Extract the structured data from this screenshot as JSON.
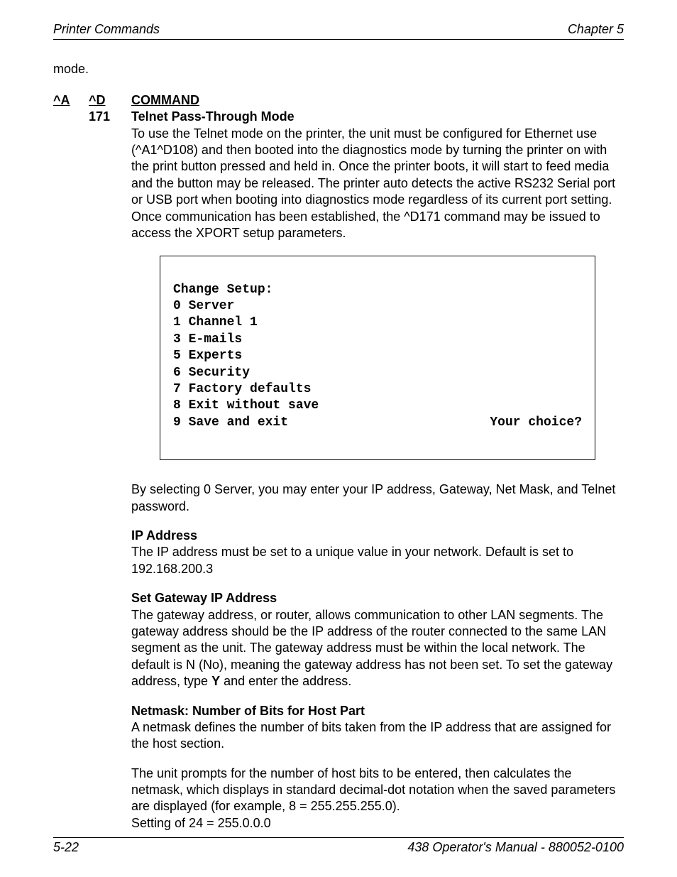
{
  "header": {
    "left": "Printer Commands",
    "right": "Chapter 5"
  },
  "top_text": "mode.",
  "cmd": {
    "colA": "^A",
    "colD": "^D",
    "colCmd": "COMMAND",
    "num": "171",
    "title": "Telnet Pass-Through Mode",
    "intro": "To use the Telnet mode on the printer, the unit must be configured for Ethernet use (^A1^D108) and then booted into the diagnostics mode by turning the printer on with the print button pressed and held in.  Once the printer boots, it will start to feed media and the button may be released.  The printer auto detects the active RS232 Serial port or USB port when booting into diagnostics mode regardless of its current port setting. Once communication has been established, the ^D171 command may be issued to access the XPORT setup parameters."
  },
  "codebox": {
    "line0": "Change Setup:",
    "line1": "0 Server",
    "line2": "1 Channel 1",
    "line3": "3 E-mails",
    "line4": "5 Experts",
    "line5": "6 Security",
    "line6": "7 Factory defaults",
    "line7": "8 Exit without save",
    "line8_left": "9 Save and exit",
    "line8_right": "Your choice?"
  },
  "sections": {
    "server_note": "By selecting 0 Server, you may enter your IP address, Gateway, Net Mask, and Telnet password.",
    "ip": {
      "heading": "IP Address",
      "body": "The IP address must be set to a unique value in your network.  Default is set to 192.168.200.3"
    },
    "gateway": {
      "heading": "Set Gateway IP Address",
      "body_pre": "The gateway address, or router, allows communication to other LAN segments. The gateway address should be the IP address of the router connected to the same LAN segment as the unit. The gateway address must be within the local network. The default is N (No), meaning the gateway address has not been set. To set the gateway address, type ",
      "bold": "Y",
      "body_post": " and enter the address."
    },
    "netmask": {
      "heading": "Netmask: Number of Bits for Host Part",
      "body1": "A netmask defines the number of bits taken from the IP address that are assigned for the host section.",
      "body2": "The unit prompts for the number of host bits to be entered, then calculates the netmask, which displays in standard decimal-dot notation when the saved parameters are displayed (for example, 8 = 255.255.255.0).",
      "body3": "Setting of 24 = 255.0.0.0"
    }
  },
  "footer": {
    "left": "5-22",
    "right": "438 Operator's Manual - 880052-0100"
  }
}
